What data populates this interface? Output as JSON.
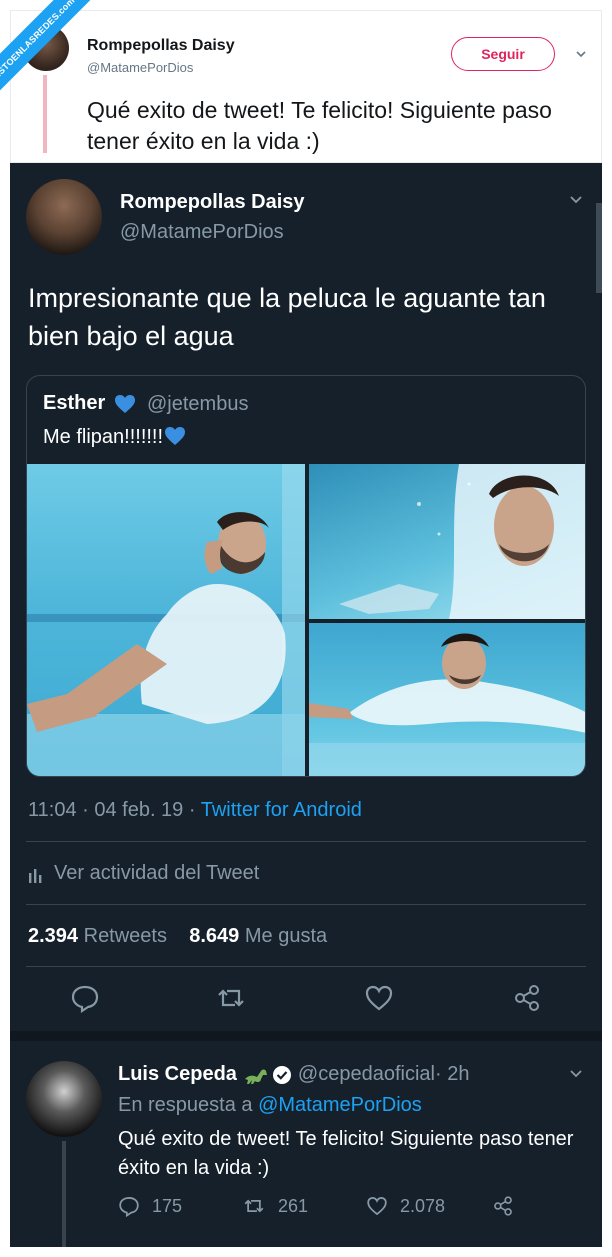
{
  "watermark": "VISTOENLASREDES.com",
  "top_tweet": {
    "name": "Rompepollas Daisy",
    "handle": "@MatamePorDios",
    "follow_label": "Seguir",
    "text": "Qué exito de tweet! Te felicito! Siguiente paso tener éxito en la vida :)"
  },
  "main_tweet": {
    "name": "Rompepollas Daisy",
    "handle": "@MatamePorDios",
    "text": "Impresionante que la peluca le aguante tan bien bajo el agua",
    "quote": {
      "name": "Esther",
      "handle": "@jetembus",
      "text": "Me flipan!!!!!!!"
    },
    "timestamp": "11:04 · 04 feb. 19 · ",
    "source": "Twitter for Android",
    "activity_label": "Ver actividad del Tweet",
    "retweets_count": "2.394",
    "retweets_label": " Retweets",
    "likes_count": "8.649",
    "likes_label": " Me gusta"
  },
  "reply": {
    "name": "Luis Cepeda",
    "handle": "@cepedaoficial",
    "time": " · 2h",
    "in_reply_prefix": "En respuesta a ",
    "in_reply_to": "@MatamePorDios",
    "text": "Qué exito de tweet! Te felicito! Siguiente paso tener éxito en la vida :)",
    "replies": "175",
    "retweets": "261",
    "likes": "2.078"
  },
  "colors": {
    "accent_blue": "#1da1f2",
    "follow_pink": "#e0245e",
    "dark_bg": "#15202b"
  }
}
